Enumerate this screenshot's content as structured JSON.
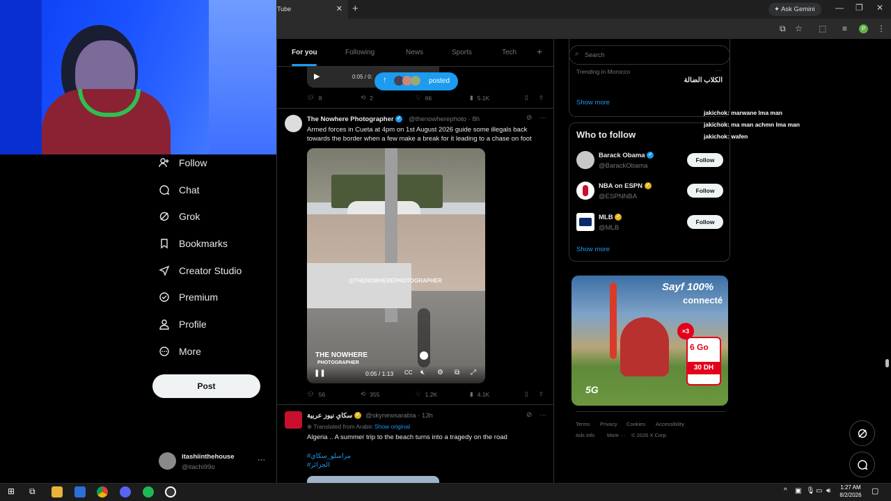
{
  "browser": {
    "tab_title": "Tube",
    "ask_gemini": "Ask Gemini",
    "profile_initial": "P"
  },
  "chat_overlay": [
    "jakichok: marwane lma man",
    "jakichok: ma man achmn lma man",
    "jakichok: wafen"
  ],
  "sidebar": {
    "items": [
      {
        "label": "Follow",
        "icon": "follow-icon"
      },
      {
        "label": "Chat",
        "icon": "chat-icon"
      },
      {
        "label": "Grok",
        "icon": "grok-icon"
      },
      {
        "label": "Bookmarks",
        "icon": "bookmark-icon"
      },
      {
        "label": "Creator Studio",
        "icon": "rocket-icon"
      },
      {
        "label": "Premium",
        "icon": "premium-icon"
      },
      {
        "label": "Profile",
        "icon": "profile-icon"
      },
      {
        "label": "More",
        "icon": "more-icon"
      }
    ],
    "post_label": "Post",
    "user": {
      "name": "itashiinthehouse",
      "handle": "@itachi99o"
    }
  },
  "feed": {
    "tabs": [
      "For you",
      "Following",
      "News",
      "Sports",
      "Tech"
    ],
    "active_tab": "For you",
    "top_video_time": "0:05 / 0:",
    "posted_pill": "posted",
    "top_actions": {
      "replies": "8",
      "reposts": "2",
      "likes": "66",
      "views": "5.1K"
    },
    "tweet1": {
      "name": "The Nowhere Photographer",
      "handle": "@thenowherephoto · 8h",
      "text": "Armed forces in Cueta at 4pm on 1st August 2026 guide some illegals back towards the border when a few make a break for it leading to a chase on foot",
      "watermark": "@THENOWHEREPHOTOGRAPHER",
      "logo_top": "THE NOWHERE",
      "logo_bottom": "PHOTOGRAPHER",
      "video_time": "0:05 / 1:13",
      "actions": {
        "replies": "56",
        "reposts": "355",
        "likes": "1.2K",
        "views": "4.1K"
      }
    },
    "tweet2": {
      "name": "سكاي نيوز عربية",
      "handle": "@skynewsarabia · 13h",
      "translated": "Translated from Arabic",
      "show_original": "Show original",
      "text": "Algeria .. A summer trip to the beach turns into a tragedy on the road",
      "hashtag1": "#مراسلو_سكاي",
      "hashtag2": "#الجزائر"
    }
  },
  "right": {
    "search_placeholder": "Search",
    "trending_label": "Trending in Morocco",
    "trending_topic": "الكلاب الضالة",
    "show_more": "Show more",
    "who_to_follow": "Who to follow",
    "suggestions": [
      {
        "name": "Barack Obama",
        "handle": "@BarackObama",
        "button": "Follow",
        "avatar_color": "#c8c8c8"
      },
      {
        "name": "NBA on ESPN",
        "handle": "@ESPNNBA",
        "button": "Follow",
        "avatar_color": "#ffffff"
      },
      {
        "name": "MLB",
        "handle": "@MLB",
        "button": "Follow",
        "avatar_color": "#ffffff"
      }
    ],
    "ad": {
      "headline": "Sayf 100%",
      "headline2": "connecté",
      "offer": "6 Go",
      "price": "30 DH",
      "badge": "5G",
      "bonus": "×3"
    },
    "footer": [
      "Terms",
      "Privacy",
      "Cookies",
      "Accessibility",
      "Ads info",
      "More ···",
      "© 2026 X Corp."
    ]
  },
  "taskbar": {
    "time": "1:27 AM",
    "date": "8/2/2026"
  },
  "colors": {
    "accent": "#1d9bf0",
    "verified_gold": "#e2b719",
    "background": "#000000"
  }
}
